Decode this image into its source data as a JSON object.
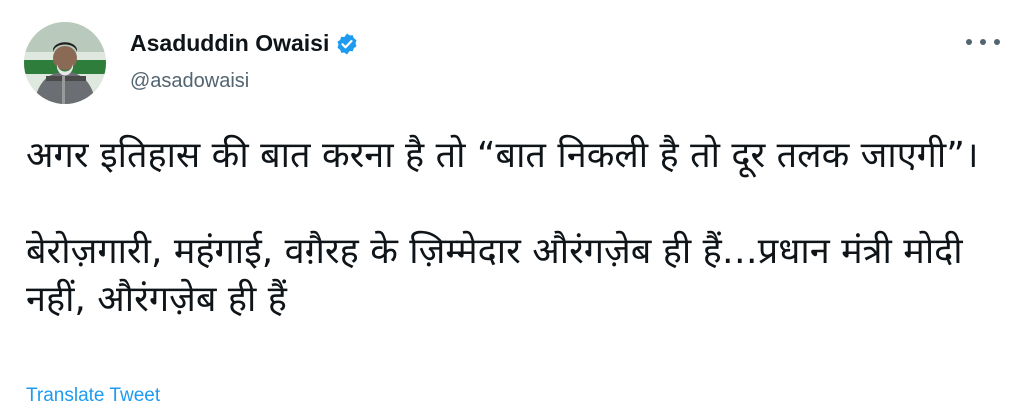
{
  "tweet": {
    "author_name": "Asaduddin Owaisi",
    "handle": "@asadowaisi",
    "paragraph_1": "अगर इतिहास की बात करना है तो “बात निकली है तो दूर तलक जाएगी”।",
    "paragraph_2": "बेरोज़गारी, महंगाई, वग़ैरह के ज़िम्मेदार औरंगज़ेब ही हैं…प्रधान मंत्री मोदी नहीं, औरंगज़ेब ही हैं",
    "translate_label": "Translate Tweet",
    "verified_icon": "verified-badge-icon",
    "more_icon": "more-options-icon"
  },
  "colors": {
    "text": "#0f1419",
    "secondary": "#536471",
    "link": "#1d9bf0"
  }
}
